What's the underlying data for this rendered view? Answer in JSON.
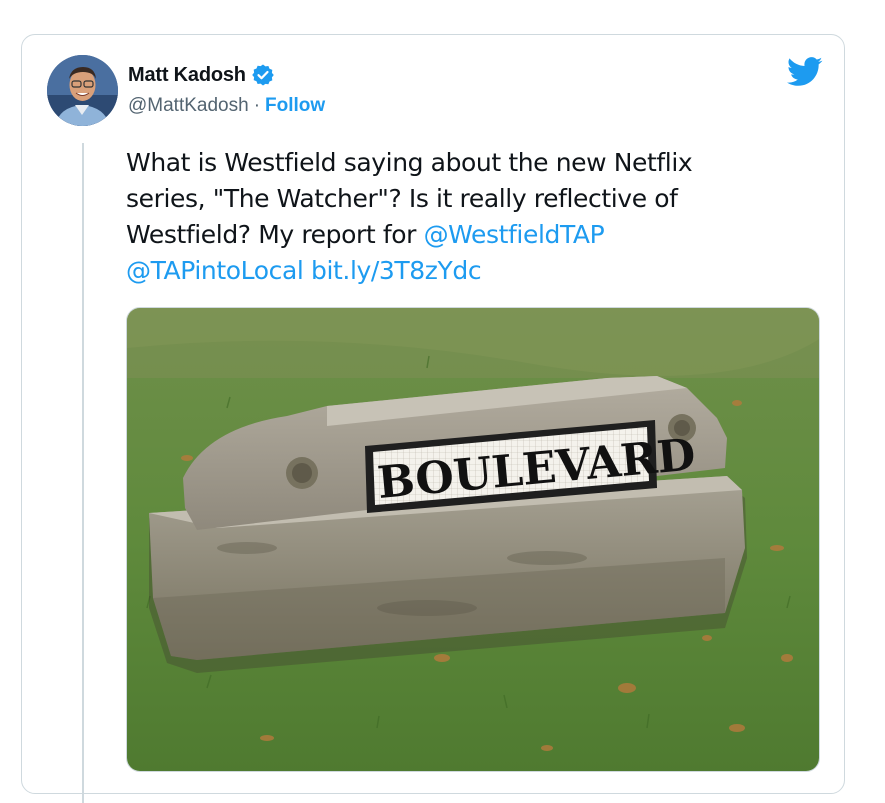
{
  "author": {
    "name": "Matt Kadosh",
    "handle": "@MattKadosh",
    "separator": "·",
    "follow_label": "Follow",
    "verified": true
  },
  "tweet": {
    "text_lines": [
      "What is Westfield saying about the new Netflix",
      "series, \"The Watcher\"? Is it really reflective of",
      "Westfield? My report for "
    ],
    "mention_1": "@WestfieldTAP",
    "mention_2": "@TAPintoLocal",
    "link": "bit.ly/3T8zYdc"
  },
  "media": {
    "sign_text": "BOULEVARD"
  },
  "icons": {
    "brand": "twitter-bird-icon",
    "verified": "verified-badge-icon"
  },
  "colors": {
    "accent": "#1d9bf0",
    "text": "#0f1419",
    "secondary": "#536471",
    "border": "#cfd9de"
  }
}
